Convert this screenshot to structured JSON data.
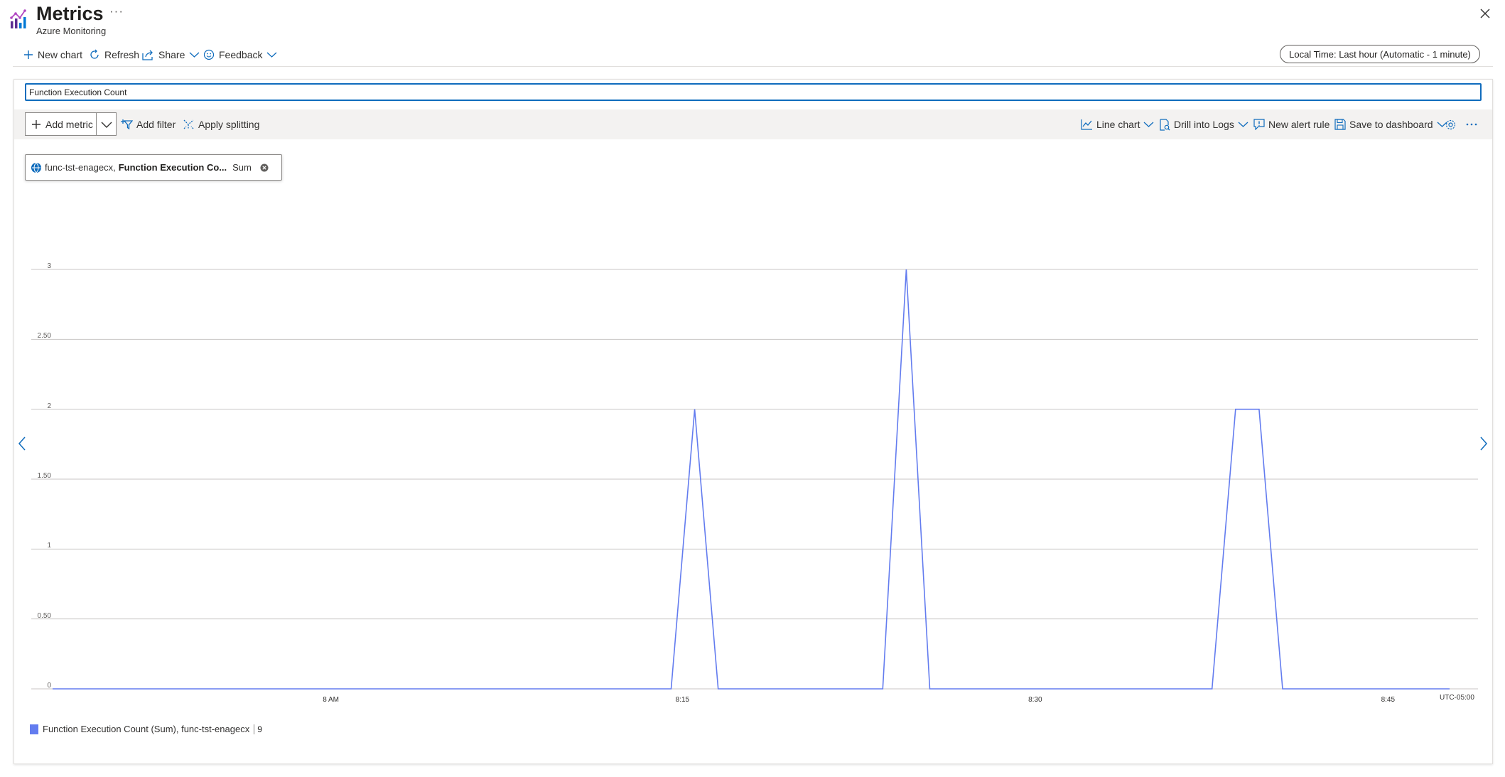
{
  "header": {
    "title": "Metrics",
    "subtitle": "Azure Monitoring",
    "more": "···"
  },
  "toolbar": {
    "new_chart": "New chart",
    "refresh": "Refresh",
    "share": "Share",
    "feedback": "Feedback",
    "time_range": "Local Time: Last hour (Automatic - 1 minute)"
  },
  "chart": {
    "title_value": "Function Execution Count",
    "add_metric": "Add metric",
    "add_filter": "Add filter",
    "apply_splitting": "Apply splitting",
    "line_chart": "Line chart",
    "drill_into_logs": "Drill into Logs",
    "new_alert_rule": "New alert rule",
    "save_to_dashboard": "Save to dashboard",
    "metric_pill": {
      "resource": "func-tst-enagecx,",
      "metric": "Function Execution Co...",
      "aggregation": "Sum"
    },
    "timezone": "UTC-05:00",
    "legend": {
      "label": "Function Execution Count (Sum), func-tst-enagecx",
      "value": "9"
    }
  },
  "colors": {
    "series": "#637cef",
    "accent": "#0f6cbd",
    "grid": "#c8c6c4"
  },
  "chart_data": {
    "type": "line",
    "y_ticks": [
      "0",
      "0.50",
      "1",
      "1.50",
      "2",
      "2.50",
      "3"
    ],
    "ylim": [
      0,
      3
    ],
    "x_ticks": [
      "8 AM",
      "8:15",
      "8:30",
      "8:45"
    ],
    "x_tick_minutes": [
      0,
      15,
      30,
      45
    ],
    "xlim_minutes": [
      -11.85,
      47.55
    ],
    "series": [
      {
        "name": "Function Execution Count (Sum), func-tst-enagecx",
        "color": "#637cef",
        "x_minutes": [
          -11.85,
          14.45,
          15.45,
          16.45,
          23.45,
          24.45,
          25.45,
          37.45,
          38.45,
          39.45,
          40.45,
          47.55
        ],
        "values": [
          0,
          0,
          2,
          0,
          0,
          3,
          0,
          0,
          2,
          2,
          0,
          0
        ]
      }
    ],
    "grid": true,
    "legend": "bottom-left"
  }
}
